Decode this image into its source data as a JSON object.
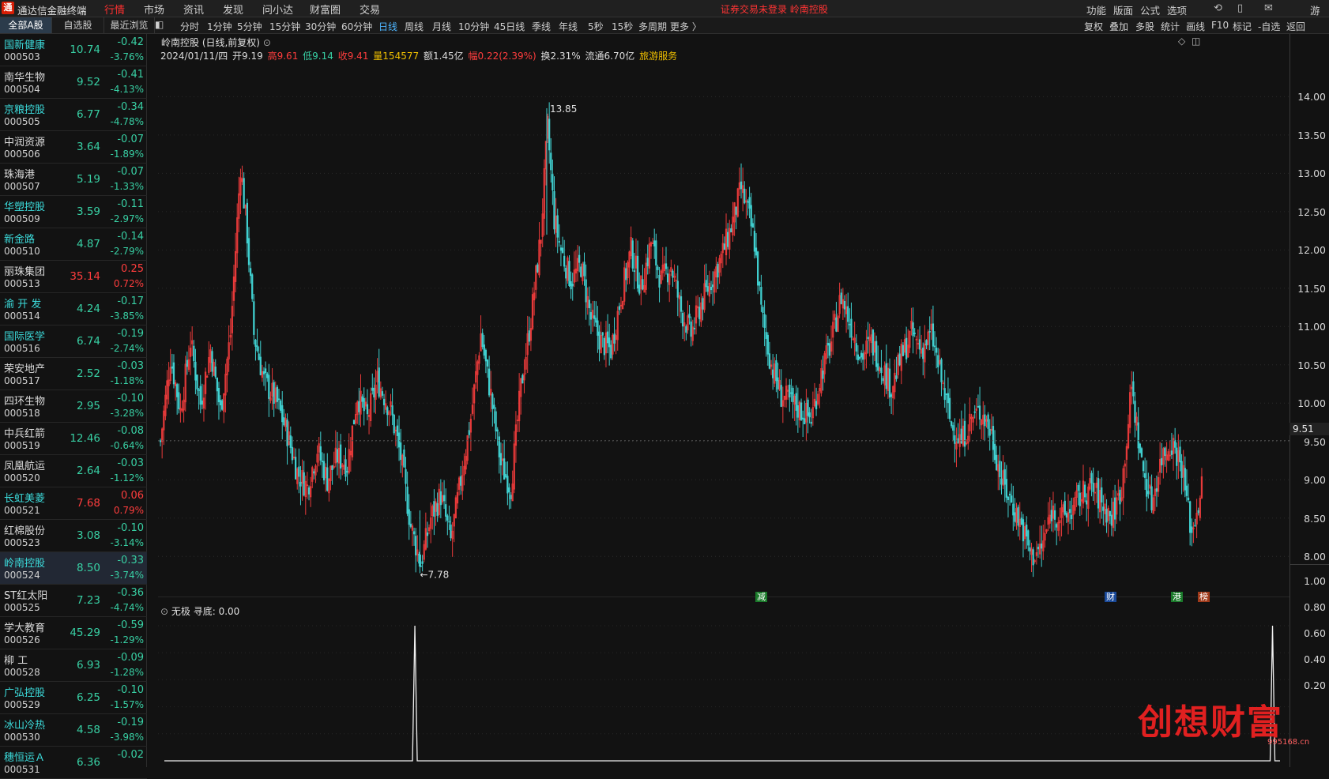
{
  "app": {
    "title": "通达信金融终端",
    "logo_char": "通",
    "login_warning": "证券交易未登录  岭南控股"
  },
  "menu": [
    "行情",
    "市场",
    "资讯",
    "发现",
    "问小达",
    "财富圈",
    "交易"
  ],
  "menu_active": 0,
  "right_menu": [
    "功能",
    "版面",
    "公式",
    "选项"
  ],
  "right_icons": [
    "⟲",
    "▯",
    "✉"
  ],
  "right_user": "游客",
  "side_tabs": [
    "全部A股",
    "自选股",
    "最近浏览"
  ],
  "period_buttons": [
    "分时",
    "1分钟",
    "5分钟",
    "15分钟",
    "30分钟",
    "60分钟",
    "日线",
    "周线",
    "月线",
    "10分钟",
    "45日线",
    "季线",
    "年线",
    "5秒",
    "15秒",
    "多周期",
    "更多 〉"
  ],
  "period_active": 6,
  "right_tools": [
    "复权",
    "叠加",
    "多股",
    "统计",
    "画线",
    "F10",
    "标记",
    "-自选",
    "返回"
  ],
  "stocks": [
    {
      "name": "国新健康",
      "code": "000503",
      "price": "10.74",
      "chg": "-0.42",
      "pct": "-3.76%",
      "name_color": "cyan"
    },
    {
      "name": "南华生物",
      "code": "000504",
      "price": "9.52",
      "chg": "-0.41",
      "pct": "-4.13%",
      "name_color": "wht"
    },
    {
      "name": "京粮控股",
      "code": "000505",
      "price": "6.77",
      "chg": "-0.34",
      "pct": "-4.78%",
      "name_color": "cyan"
    },
    {
      "name": "中润资源",
      "code": "000506",
      "price": "3.64",
      "chg": "-0.07",
      "pct": "-1.89%",
      "name_color": "wht"
    },
    {
      "name": "珠海港",
      "code": "000507",
      "price": "5.19",
      "chg": "-0.07",
      "pct": "-1.33%",
      "name_color": "wht"
    },
    {
      "name": "华塑控股",
      "code": "000509",
      "price": "3.59",
      "chg": "-0.11",
      "pct": "-2.97%",
      "name_color": "cyan"
    },
    {
      "name": "新金路",
      "code": "000510",
      "price": "4.87",
      "chg": "-0.14",
      "pct": "-2.79%",
      "name_color": "cyan"
    },
    {
      "name": "丽珠集团",
      "code": "000513",
      "price": "35.14",
      "chg": "0.25",
      "pct": "0.72%",
      "name_color": "wht"
    },
    {
      "name": "渝 开 发",
      "code": "000514",
      "price": "4.24",
      "chg": "-0.17",
      "pct": "-3.85%",
      "name_color": "cyan"
    },
    {
      "name": "国际医学",
      "code": "000516",
      "price": "6.74",
      "chg": "-0.19",
      "pct": "-2.74%",
      "name_color": "cyan"
    },
    {
      "name": "荣安地产",
      "code": "000517",
      "price": "2.52",
      "chg": "-0.03",
      "pct": "-1.18%",
      "name_color": "wht"
    },
    {
      "name": "四环生物",
      "code": "000518",
      "price": "2.95",
      "chg": "-0.10",
      "pct": "-3.28%",
      "name_color": "wht"
    },
    {
      "name": "中兵红箭",
      "code": "000519",
      "price": "12.46",
      "chg": "-0.08",
      "pct": "-0.64%",
      "name_color": "wht"
    },
    {
      "name": "凤凰航运",
      "code": "000520",
      "price": "2.64",
      "chg": "-0.03",
      "pct": "-1.12%",
      "name_color": "wht"
    },
    {
      "name": "长虹美菱",
      "code": "000521",
      "price": "7.68",
      "chg": "0.06",
      "pct": "0.79%",
      "name_color": "cyan"
    },
    {
      "name": "红棉股份",
      "code": "000523",
      "price": "3.08",
      "chg": "-0.10",
      "pct": "-3.14%",
      "name_color": "wht"
    },
    {
      "name": "岭南控股",
      "code": "000524",
      "price": "8.50",
      "chg": "-0.33",
      "pct": "-3.74%",
      "name_color": "cyan"
    },
    {
      "name": "ST红太阳",
      "code": "000525",
      "price": "7.23",
      "chg": "-0.36",
      "pct": "-4.74%",
      "name_color": "wht"
    },
    {
      "name": "学大教育",
      "code": "000526",
      "price": "45.29",
      "chg": "-0.59",
      "pct": "-1.29%",
      "name_color": "wht"
    },
    {
      "name": "柳 工",
      "code": "000528",
      "price": "6.93",
      "chg": "-0.09",
      "pct": "-1.28%",
      "name_color": "wht"
    },
    {
      "name": "广弘控股",
      "code": "000529",
      "price": "6.25",
      "chg": "-0.10",
      "pct": "-1.57%",
      "name_color": "cyan"
    },
    {
      "name": "冰山冷热",
      "code": "000530",
      "price": "4.58",
      "chg": "-0.19",
      "pct": "-3.98%",
      "name_color": "cyan"
    },
    {
      "name": "穗恒运Ａ",
      "code": "000531",
      "price": "6.36",
      "chg": "-0.02",
      "pct": "",
      "name_color": "cyan"
    }
  ],
  "selected_stock": 16,
  "chart": {
    "title": "岭南控股 (日线,前复权)",
    "info": {
      "date": "2024/01/11/四",
      "open": "开9.19",
      "high": "高9.61",
      "low": "低9.14",
      "close": "收9.41",
      "volume": "量154577",
      "amount": "额1.45亿",
      "range": "幅0.22(2.39%)",
      "turnover": "换2.31%",
      "float": "流通6.70亿",
      "sector": "旅游服务"
    },
    "current_price_label": "9.51",
    "high_label": "13.85",
    "low_label": "←7.78",
    "event_tags": [
      {
        "text": "减",
        "color": "#1a7a2a"
      },
      {
        "text": "财",
        "color": "#1a4a9a"
      },
      {
        "text": "港",
        "color": "#1a7a2a"
      },
      {
        "text": "榜",
        "color": "#a03a1a"
      }
    ],
    "sub_title": "无极  寻底: 0.00",
    "colors": {
      "up": "#e83a3a",
      "down": "#40d0d0",
      "bg": "#121212"
    }
  },
  "chart_data": {
    "type": "candlestick",
    "price_ylim": [
      7.6,
      14.2
    ],
    "price_ticks": [
      "14.00",
      "13.50",
      "13.00",
      "12.50",
      "12.00",
      "11.50",
      "11.00",
      "10.50",
      "10.00",
      "9.50",
      "9.00",
      "8.50",
      "8.00"
    ],
    "sub_ylim": [
      0,
      1.0
    ],
    "sub_ticks": [
      "1.00",
      "0.80",
      "0.60",
      "0.40",
      "0.20"
    ],
    "swing_points": [
      [
        0,
        9.5
      ],
      [
        6,
        10.6
      ],
      [
        12,
        9.9
      ],
      [
        18,
        10.8
      ],
      [
        24,
        10.0
      ],
      [
        30,
        10.7
      ],
      [
        36,
        9.9
      ],
      [
        42,
        10.9
      ],
      [
        48,
        13.1
      ],
      [
        52,
        12.2
      ],
      [
        56,
        10.9
      ],
      [
        62,
        10.3
      ],
      [
        70,
        10.0
      ],
      [
        76,
        9.6
      ],
      [
        82,
        9.1
      ],
      [
        88,
        8.9
      ],
      [
        94,
        9.4
      ],
      [
        100,
        9.0
      ],
      [
        106,
        9.3
      ],
      [
        112,
        9.2
      ],
      [
        118,
        10.1
      ],
      [
        124,
        9.8
      ],
      [
        130,
        10.3
      ],
      [
        138,
        9.9
      ],
      [
        144,
        9.3
      ],
      [
        150,
        8.4
      ],
      [
        156,
        7.9
      ],
      [
        162,
        8.5
      ],
      [
        168,
        8.8
      ],
      [
        174,
        8.2
      ],
      [
        180,
        9.0
      ],
      [
        186,
        9.8
      ],
      [
        192,
        10.9
      ],
      [
        198,
        10.1
      ],
      [
        204,
        9.2
      ],
      [
        210,
        8.9
      ],
      [
        216,
        10.2
      ],
      [
        222,
        11.1
      ],
      [
        228,
        12.2
      ],
      [
        232,
        13.6
      ],
      [
        236,
        12.4
      ],
      [
        240,
        12.0
      ],
      [
        246,
        11.6
      ],
      [
        252,
        11.8
      ],
      [
        258,
        11.1
      ],
      [
        264,
        10.8
      ],
      [
        270,
        10.7
      ],
      [
        276,
        11.4
      ],
      [
        282,
        12.0
      ],
      [
        288,
        11.5
      ],
      [
        294,
        12.1
      ],
      [
        300,
        11.6
      ],
      [
        306,
        11.8
      ],
      [
        312,
        11.2
      ],
      [
        318,
        10.9
      ],
      [
        324,
        11.3
      ],
      [
        330,
        11.6
      ],
      [
        336,
        11.9
      ],
      [
        342,
        12.3
      ],
      [
        348,
        12.8
      ],
      [
        352,
        12.5
      ],
      [
        356,
        12.1
      ],
      [
        360,
        11.2
      ],
      [
        366,
        10.5
      ],
      [
        372,
        10.1
      ],
      [
        378,
        10.0
      ],
      [
        384,
        9.9
      ],
      [
        390,
        9.8
      ],
      [
        396,
        10.4
      ],
      [
        402,
        10.8
      ],
      [
        408,
        11.4
      ],
      [
        414,
        11.0
      ],
      [
        420,
        10.6
      ],
      [
        426,
        10.8
      ],
      [
        432,
        10.5
      ],
      [
        438,
        10.2
      ],
      [
        444,
        10.6
      ],
      [
        450,
        10.9
      ],
      [
        456,
        10.7
      ],
      [
        462,
        10.9
      ],
      [
        468,
        10.3
      ],
      [
        474,
        9.7
      ],
      [
        480,
        9.5
      ],
      [
        486,
        9.8
      ],
      [
        492,
        9.9
      ],
      [
        498,
        9.6
      ],
      [
        504,
        9.0
      ],
      [
        510,
        8.7
      ],
      [
        516,
        8.4
      ],
      [
        522,
        8.0
      ],
      [
        528,
        8.1
      ],
      [
        534,
        8.6
      ],
      [
        540,
        8.5
      ],
      [
        546,
        8.6
      ],
      [
        552,
        8.8
      ],
      [
        558,
        8.9
      ],
      [
        564,
        8.7
      ],
      [
        570,
        8.5
      ],
      [
        576,
        8.9
      ],
      [
        582,
        10.2
      ],
      [
        588,
        9.2
      ],
      [
        594,
        8.7
      ],
      [
        600,
        9.3
      ],
      [
        606,
        9.5
      ],
      [
        612,
        9.2
      ],
      [
        618,
        8.3
      ],
      [
        624,
        8.9
      ]
    ],
    "extremes": {
      "high": 13.85,
      "low": 7.78
    },
    "signal_spikes": [
      {
        "x_frac": 0.227,
        "value": 1.0
      },
      {
        "x_frac": 0.985,
        "value": 1.0
      }
    ]
  }
}
